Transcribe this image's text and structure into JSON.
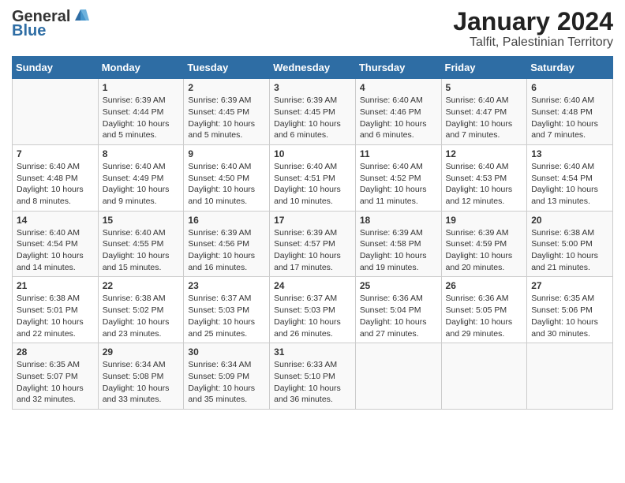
{
  "header": {
    "logo_general": "General",
    "logo_blue": "Blue",
    "title": "January 2024",
    "subtitle": "Talfit, Palestinian Territory"
  },
  "calendar": {
    "days_of_week": [
      "Sunday",
      "Monday",
      "Tuesday",
      "Wednesday",
      "Thursday",
      "Friday",
      "Saturday"
    ],
    "weeks": [
      [
        {
          "day": "",
          "info": ""
        },
        {
          "day": "1",
          "info": "Sunrise: 6:39 AM\nSunset: 4:44 PM\nDaylight: 10 hours\nand 5 minutes."
        },
        {
          "day": "2",
          "info": "Sunrise: 6:39 AM\nSunset: 4:45 PM\nDaylight: 10 hours\nand 5 minutes."
        },
        {
          "day": "3",
          "info": "Sunrise: 6:39 AM\nSunset: 4:45 PM\nDaylight: 10 hours\nand 6 minutes."
        },
        {
          "day": "4",
          "info": "Sunrise: 6:40 AM\nSunset: 4:46 PM\nDaylight: 10 hours\nand 6 minutes."
        },
        {
          "day": "5",
          "info": "Sunrise: 6:40 AM\nSunset: 4:47 PM\nDaylight: 10 hours\nand 7 minutes."
        },
        {
          "day": "6",
          "info": "Sunrise: 6:40 AM\nSunset: 4:48 PM\nDaylight: 10 hours\nand 7 minutes."
        }
      ],
      [
        {
          "day": "7",
          "info": "Sunrise: 6:40 AM\nSunset: 4:48 PM\nDaylight: 10 hours\nand 8 minutes."
        },
        {
          "day": "8",
          "info": "Sunrise: 6:40 AM\nSunset: 4:49 PM\nDaylight: 10 hours\nand 9 minutes."
        },
        {
          "day": "9",
          "info": "Sunrise: 6:40 AM\nSunset: 4:50 PM\nDaylight: 10 hours\nand 10 minutes."
        },
        {
          "day": "10",
          "info": "Sunrise: 6:40 AM\nSunset: 4:51 PM\nDaylight: 10 hours\nand 10 minutes."
        },
        {
          "day": "11",
          "info": "Sunrise: 6:40 AM\nSunset: 4:52 PM\nDaylight: 10 hours\nand 11 minutes."
        },
        {
          "day": "12",
          "info": "Sunrise: 6:40 AM\nSunset: 4:53 PM\nDaylight: 10 hours\nand 12 minutes."
        },
        {
          "day": "13",
          "info": "Sunrise: 6:40 AM\nSunset: 4:54 PM\nDaylight: 10 hours\nand 13 minutes."
        }
      ],
      [
        {
          "day": "14",
          "info": "Sunrise: 6:40 AM\nSunset: 4:54 PM\nDaylight: 10 hours\nand 14 minutes."
        },
        {
          "day": "15",
          "info": "Sunrise: 6:40 AM\nSunset: 4:55 PM\nDaylight: 10 hours\nand 15 minutes."
        },
        {
          "day": "16",
          "info": "Sunrise: 6:39 AM\nSunset: 4:56 PM\nDaylight: 10 hours\nand 16 minutes."
        },
        {
          "day": "17",
          "info": "Sunrise: 6:39 AM\nSunset: 4:57 PM\nDaylight: 10 hours\nand 17 minutes."
        },
        {
          "day": "18",
          "info": "Sunrise: 6:39 AM\nSunset: 4:58 PM\nDaylight: 10 hours\nand 19 minutes."
        },
        {
          "day": "19",
          "info": "Sunrise: 6:39 AM\nSunset: 4:59 PM\nDaylight: 10 hours\nand 20 minutes."
        },
        {
          "day": "20",
          "info": "Sunrise: 6:38 AM\nSunset: 5:00 PM\nDaylight: 10 hours\nand 21 minutes."
        }
      ],
      [
        {
          "day": "21",
          "info": "Sunrise: 6:38 AM\nSunset: 5:01 PM\nDaylight: 10 hours\nand 22 minutes."
        },
        {
          "day": "22",
          "info": "Sunrise: 6:38 AM\nSunset: 5:02 PM\nDaylight: 10 hours\nand 23 minutes."
        },
        {
          "day": "23",
          "info": "Sunrise: 6:37 AM\nSunset: 5:03 PM\nDaylight: 10 hours\nand 25 minutes."
        },
        {
          "day": "24",
          "info": "Sunrise: 6:37 AM\nSunset: 5:03 PM\nDaylight: 10 hours\nand 26 minutes."
        },
        {
          "day": "25",
          "info": "Sunrise: 6:36 AM\nSunset: 5:04 PM\nDaylight: 10 hours\nand 27 minutes."
        },
        {
          "day": "26",
          "info": "Sunrise: 6:36 AM\nSunset: 5:05 PM\nDaylight: 10 hours\nand 29 minutes."
        },
        {
          "day": "27",
          "info": "Sunrise: 6:35 AM\nSunset: 5:06 PM\nDaylight: 10 hours\nand 30 minutes."
        }
      ],
      [
        {
          "day": "28",
          "info": "Sunrise: 6:35 AM\nSunset: 5:07 PM\nDaylight: 10 hours\nand 32 minutes."
        },
        {
          "day": "29",
          "info": "Sunrise: 6:34 AM\nSunset: 5:08 PM\nDaylight: 10 hours\nand 33 minutes."
        },
        {
          "day": "30",
          "info": "Sunrise: 6:34 AM\nSunset: 5:09 PM\nDaylight: 10 hours\nand 35 minutes."
        },
        {
          "day": "31",
          "info": "Sunrise: 6:33 AM\nSunset: 5:10 PM\nDaylight: 10 hours\nand 36 minutes."
        },
        {
          "day": "",
          "info": ""
        },
        {
          "day": "",
          "info": ""
        },
        {
          "day": "",
          "info": ""
        }
      ]
    ]
  }
}
